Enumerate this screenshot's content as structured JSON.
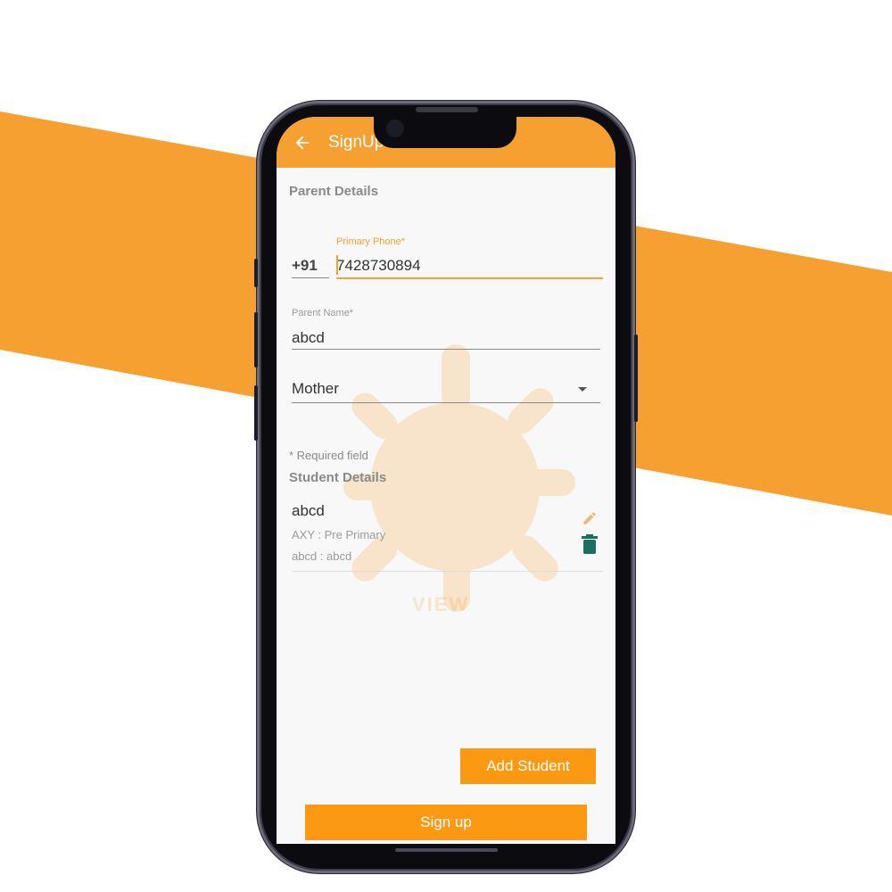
{
  "colors": {
    "accent": "#f5a030",
    "button": "#fb9a12",
    "delete_icon": "#1c6f5e",
    "edit_icon": "#f6b47a"
  },
  "appbar": {
    "title": "SignUp - Parent Info",
    "back_icon": "arrow-left-icon"
  },
  "parent_section": {
    "heading": "Parent Details"
  },
  "phone": {
    "country_code": "+91",
    "label": "Primary Phone*",
    "value": "7428730894"
  },
  "parent_name": {
    "label": "Parent Name*",
    "value": "abcd"
  },
  "relation": {
    "selected": "Mother",
    "icon": "chevron-down-icon"
  },
  "required_note": "* Required field",
  "student_section": {
    "heading": "Student Details"
  },
  "students": [
    {
      "name": "abcd",
      "line1": "AXY : Pre Primary",
      "line2": "abcd : abcd",
      "edit_icon": "pencil-icon",
      "delete_icon": "trash-icon"
    }
  ],
  "buttons": {
    "add_student": "Add Student",
    "sign_up": "Sign up"
  },
  "watermark": {
    "text": "VIEW"
  }
}
